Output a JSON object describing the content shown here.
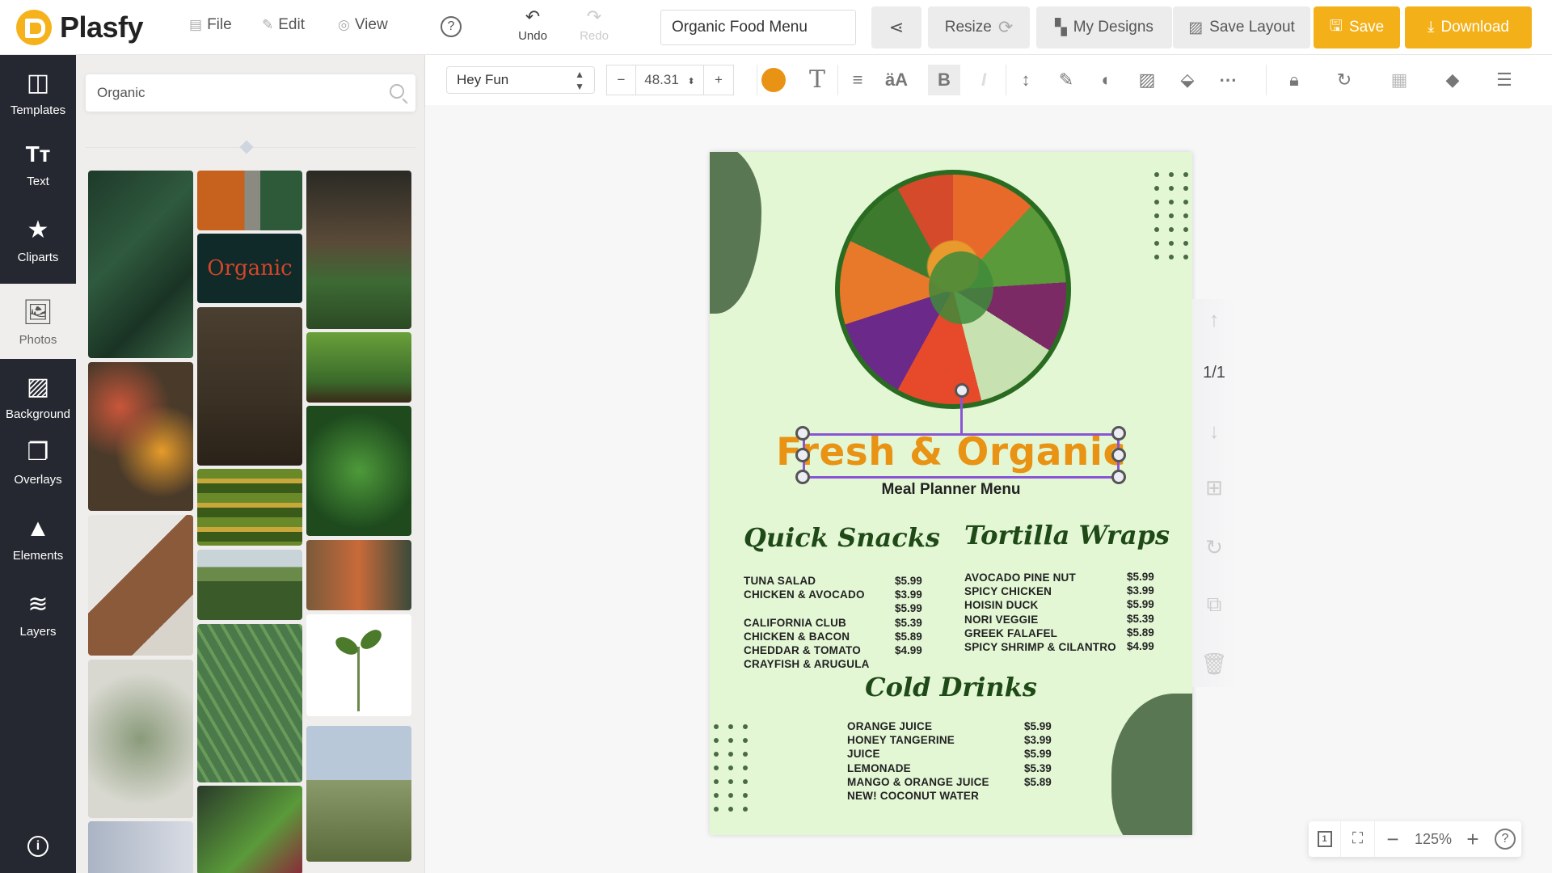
{
  "app": {
    "name": "Plasfy"
  },
  "topbar": {
    "menu": [
      {
        "label": "File",
        "icon": "file-icon"
      },
      {
        "label": "Edit",
        "icon": "pencil-icon"
      },
      {
        "label": "View",
        "icon": "eye-icon"
      }
    ],
    "help_glyph": "?",
    "undo_label": "Undo",
    "redo_label": "Redo",
    "document_name": "Organic Food Menu",
    "resize_label": "Resize",
    "my_designs_label": "My Designs",
    "save_layout_label": "Save Layout",
    "save_label": "Save",
    "download_label": "Download",
    "accent_color": "#f4b018"
  },
  "rail": {
    "items": [
      {
        "label": "Templates",
        "icon": "templates-icon"
      },
      {
        "label": "Text",
        "icon": "text-icon"
      },
      {
        "label": "Cliparts",
        "icon": "star-icon"
      },
      {
        "label": "Photos",
        "icon": "photos-icon",
        "active": true
      },
      {
        "label": "Background",
        "icon": "background-icon"
      },
      {
        "label": "Overlays",
        "icon": "overlays-icon"
      },
      {
        "label": "Elements",
        "icon": "shapes-icon"
      },
      {
        "label": "Layers",
        "icon": "layers-icon"
      }
    ],
    "info_glyph": "i"
  },
  "panel": {
    "search_value": "Organic",
    "photos": [
      {
        "name": "dark-green-leaves"
      },
      {
        "name": "carrots-bunch"
      },
      {
        "name": "organic-word-chili"
      },
      {
        "name": "watering-can-plants"
      },
      {
        "name": "vegetables-market"
      },
      {
        "name": "hands-soil"
      },
      {
        "name": "seedlings-row"
      },
      {
        "name": "water-drops-leaf"
      },
      {
        "name": "produce-shelves"
      },
      {
        "name": "wooden-board-shadow"
      },
      {
        "name": "farm-fields"
      },
      {
        "name": "market-stall"
      },
      {
        "name": "eucalyptus-branches"
      },
      {
        "name": "big-green-leaf"
      },
      {
        "name": "sprout"
      },
      {
        "name": "wheat-field"
      },
      {
        "name": "jars"
      },
      {
        "name": "gardening-gloves"
      }
    ]
  },
  "toolbar": {
    "font_family": "Hey Fun",
    "font_size": "48.31",
    "minus": "−",
    "plus": "+",
    "text_color": "#e99314"
  },
  "design": {
    "title": "Fresh & Organic",
    "subtitle": "Meal Planner Menu",
    "sections": [
      {
        "heading": "Quick Snacks",
        "items": [
          "TUNA SALAD",
          "CHICKEN & AVOCADO",
          "",
          "CALIFORNIA CLUB",
          "CHICKEN & BACON",
          "CHEDDAR & TOMATO",
          "CRAYFISH & ARUGULA"
        ],
        "prices": [
          "$5.99",
          "$3.99",
          "$5.99",
          "$5.39",
          "$5.89",
          "$4.99"
        ]
      },
      {
        "heading": "Tortilla Wraps",
        "items": [
          "AVOCADO PINE NUT",
          "SPICY CHICKEN",
          "HOISIN DUCK",
          "NORI VEGGIE",
          "GREEK FALAFEL",
          "SPICY SHRIMP & CILANTRO"
        ],
        "prices": [
          "$5.99",
          "$3.99",
          "$5.99",
          "$5.39",
          "$5.89",
          "$4.99"
        ]
      },
      {
        "heading": "Cold Drinks",
        "items": [
          "ORANGE JUICE",
          "HONEY TANGERINE",
          "JUICE",
          "LEMONADE",
          "MANGO & ORANGE JUICE",
          "NEW! COCONUT WATER"
        ],
        "prices": [
          "$5.99",
          "$3.99",
          "$5.99",
          "$5.39",
          "$5.89"
        ]
      }
    ],
    "background_color": "#e3f7d5",
    "shape_color": "#597753",
    "heading_color": "#1f4a18"
  },
  "page_controls": {
    "page_count": "1/1"
  },
  "zoom": {
    "value": "125%",
    "page_badge": "1"
  }
}
